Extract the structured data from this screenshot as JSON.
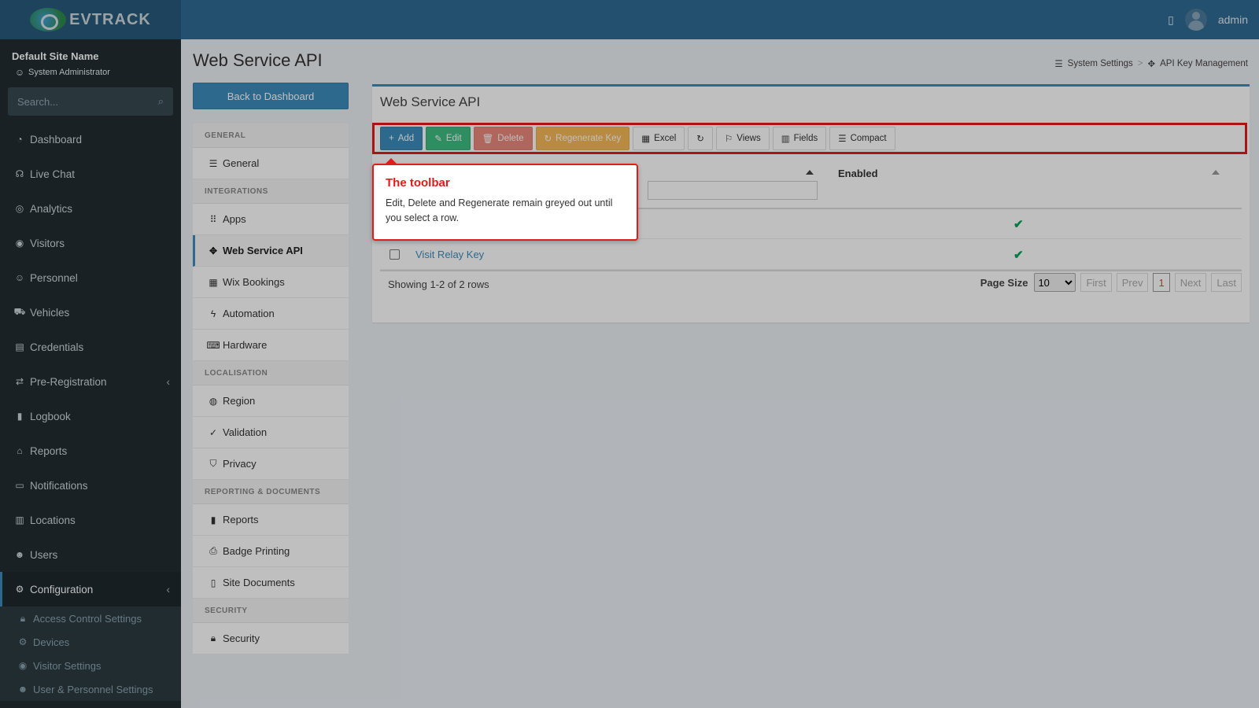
{
  "header": {
    "brand": "EVTRACK",
    "user": "admin"
  },
  "sidebar": {
    "site_name": "Default Site Name",
    "role": "System Administrator",
    "search_placeholder": "Search...",
    "items": [
      {
        "label": "Dashboard",
        "icon": "dashboard-icon"
      },
      {
        "label": "Live Chat",
        "icon": "headset-icon"
      },
      {
        "label": "Analytics",
        "icon": "target-icon"
      },
      {
        "label": "Visitors",
        "icon": "eye-icon"
      },
      {
        "label": "Personnel",
        "icon": "user-icon"
      },
      {
        "label": "Vehicles",
        "icon": "car-icon"
      },
      {
        "label": "Credentials",
        "icon": "id-card-icon"
      },
      {
        "label": "Pre-Registration",
        "icon": "exchange-icon"
      },
      {
        "label": "Logbook",
        "icon": "book-icon"
      },
      {
        "label": "Reports",
        "icon": "chart-icon"
      },
      {
        "label": "Notifications",
        "icon": "comment-icon"
      },
      {
        "label": "Locations",
        "icon": "building-icon"
      },
      {
        "label": "Users",
        "icon": "users-icon"
      },
      {
        "label": "Configuration",
        "icon": "gear-icon"
      }
    ],
    "subitems": [
      "Access Control Settings",
      "Devices",
      "Visitor Settings",
      "User & Personnel Settings"
    ]
  },
  "page": {
    "title": "Web Service API",
    "back_button": "Back to Dashboard",
    "breadcrumb": [
      "System Settings",
      "API Key Management"
    ]
  },
  "settings_menu": {
    "general_header": "GENERAL",
    "general": "General",
    "integrations_header": "INTEGRATIONS",
    "apps": "Apps",
    "web_service_api": "Web Service API",
    "wix": "Wix Bookings",
    "automation": "Automation",
    "hardware": "Hardware",
    "localisation_header": "LOCALISATION",
    "region": "Region",
    "validation": "Validation",
    "privacy": "Privacy",
    "reporting_header": "REPORTING & DOCUMENTS",
    "reports": "Reports",
    "badge": "Badge Printing",
    "site_docs": "Site Documents",
    "security_header": "SECURITY",
    "security": "Security"
  },
  "panel": {
    "title": "Web Service API",
    "toolbar": {
      "add": "Add",
      "edit": "Edit",
      "delete": "Delete",
      "regen": "Regenerate Key",
      "excel": "Excel",
      "views": "Views",
      "fields": "Fields",
      "compact": "Compact"
    },
    "columns": {
      "enabled": "Enabled"
    },
    "rows": [
      {
        "name": "",
        "enabled": "✔"
      },
      {
        "name": "Visit Relay Key",
        "enabled": "✔"
      }
    ],
    "showing": "Showing 1-2 of 2 rows",
    "page_size_label": "Page Size",
    "page_size": "10",
    "pager": {
      "first": "First",
      "prev": "Prev",
      "current": "1",
      "next": "Next",
      "last": "Last"
    }
  },
  "tooltip": {
    "title": "The toolbar",
    "body": "Edit, Delete and Regenerate remain greyed out until you select a row."
  },
  "colors": {
    "highlight": "#e31b1b",
    "primary": "#3c8dbc",
    "sidebar": "#222d32"
  }
}
